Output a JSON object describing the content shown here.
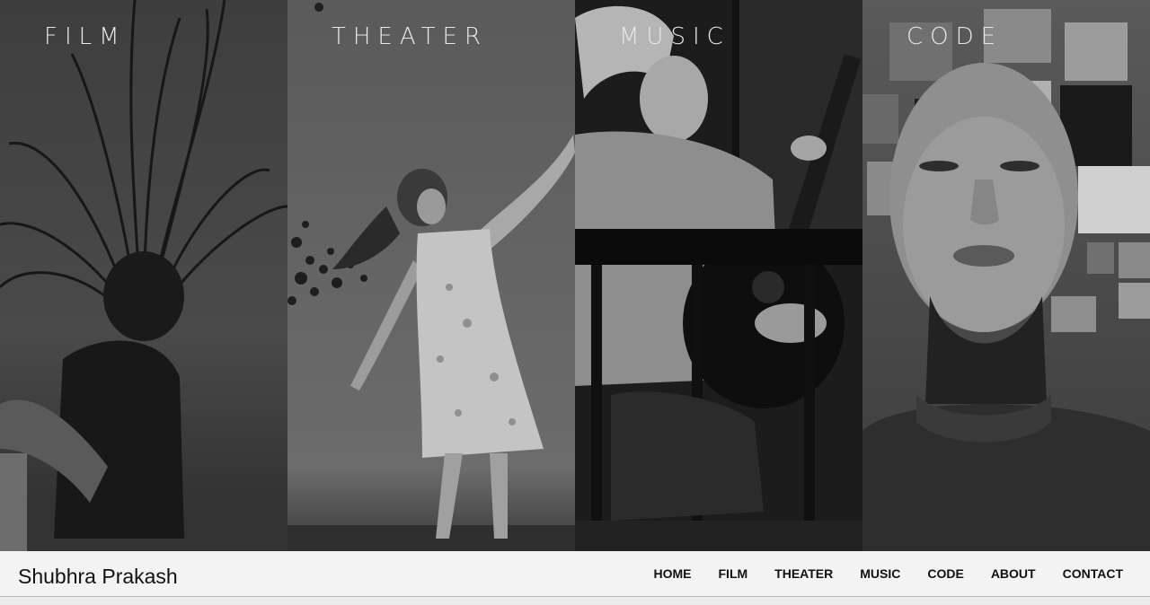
{
  "panels": [
    {
      "title": "FILM",
      "photo": "woman-hair-flip-photo"
    },
    {
      "title": "THEATER",
      "photo": "dancer-photo"
    },
    {
      "title": "MUSIC",
      "photo": "guitarist-photo"
    },
    {
      "title": "CODE",
      "photo": "collage-face-photo"
    }
  ],
  "footer": {
    "brand": "Shubhra Prakash",
    "nav": [
      "HOME",
      "FILM",
      "THEATER",
      "MUSIC",
      "CODE",
      "ABOUT",
      "CONTACT"
    ]
  },
  "colors": {
    "panel_title": "#e8e8e8",
    "footer_bg": "#f3f3f3",
    "footer_text": "#111111"
  }
}
